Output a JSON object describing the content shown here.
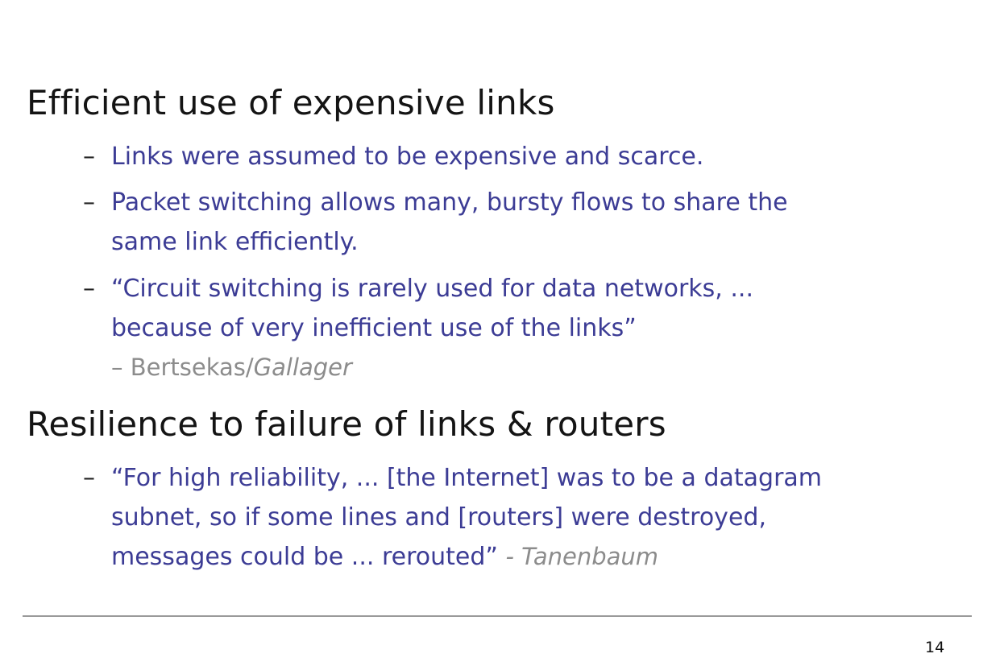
{
  "section1": {
    "heading": "Efficient use of expensive links",
    "bullets": [
      {
        "dash": "–",
        "lines": [
          "Links were assumed to be expensive and scarce."
        ]
      },
      {
        "dash": "–",
        "lines": [
          "Packet switching allows many, bursty flows to share the",
          "same link efficiently."
        ]
      },
      {
        "dash": "–",
        "quote_open": "“",
        "lines": [
          "Circuit switching is rarely used for data networks, ...",
          "because of very inefficient use of the links"
        ],
        "quote_close": "”",
        "attribution_prefix": "– Bertsekas/",
        "attribution_italic": "Gallager"
      }
    ]
  },
  "section2": {
    "heading": "Resilience to failure of links & routers",
    "bullets": [
      {
        "dash": "–",
        "lines": [
          "“For high reliability, ... [the Internet] was to be a datagram",
          "subnet, so if some lines and [routers] were destroyed,",
          "messages could be ... rerouted"
        ],
        "quote_close": "”",
        "attribution": "- Tanenbaum"
      }
    ]
  },
  "page_number": "14"
}
